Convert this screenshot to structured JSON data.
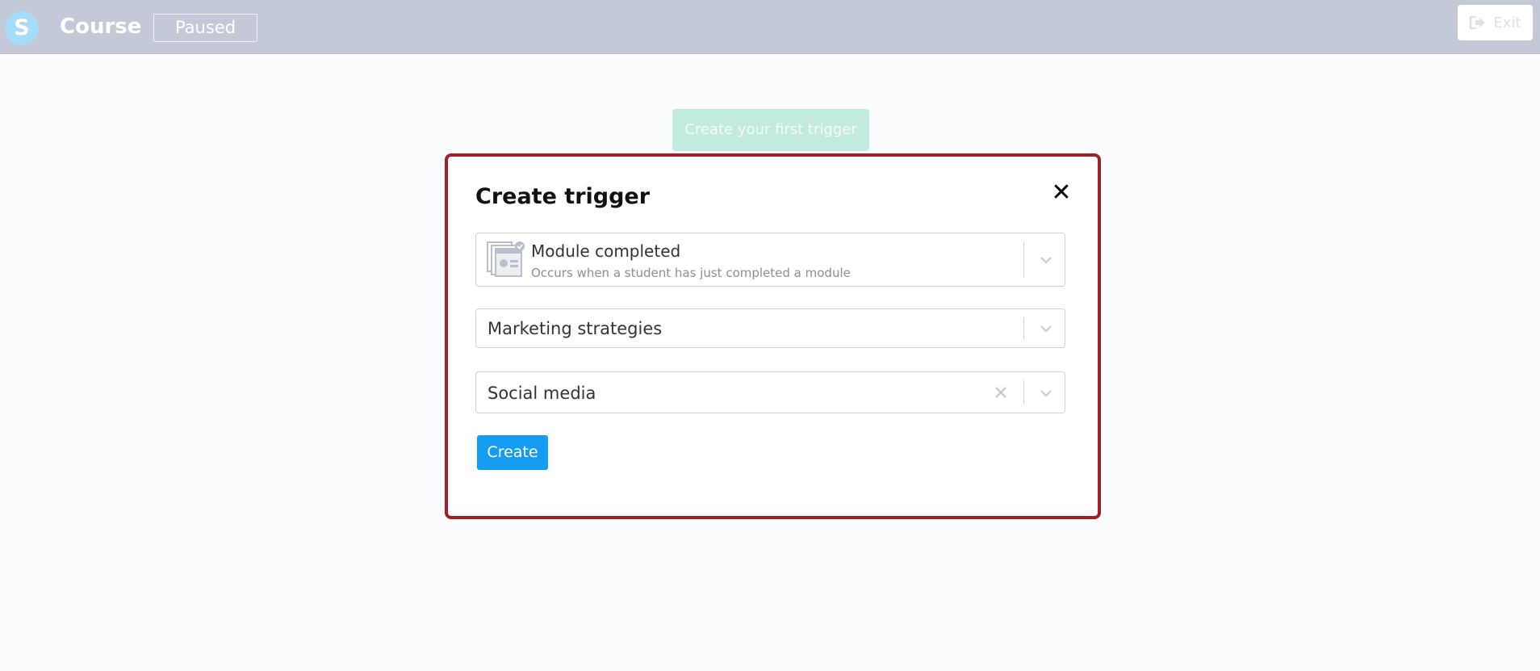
{
  "header": {
    "logo_letter": "S",
    "title": "Course",
    "status": "Paused",
    "exit_label": "Exit",
    "exit_icon": "sign-out-icon"
  },
  "backdrop": {
    "first_trigger_label": "Create your first trigger"
  },
  "modal": {
    "title": "Create trigger",
    "close_icon": "close-icon",
    "trigger_type": {
      "icon": "module-completed-icon",
      "label": "Module completed",
      "description": "Occurs when a student has just completed a module"
    },
    "course_select": {
      "value": "Marketing strategies"
    },
    "module_select": {
      "value": "Social media"
    },
    "create_label": "Create"
  },
  "colors": {
    "header_bg": "#c4c9d7",
    "modal_border": "#a11f27",
    "primary": "#139cf0",
    "backdrop_button": "#c3eadf"
  }
}
